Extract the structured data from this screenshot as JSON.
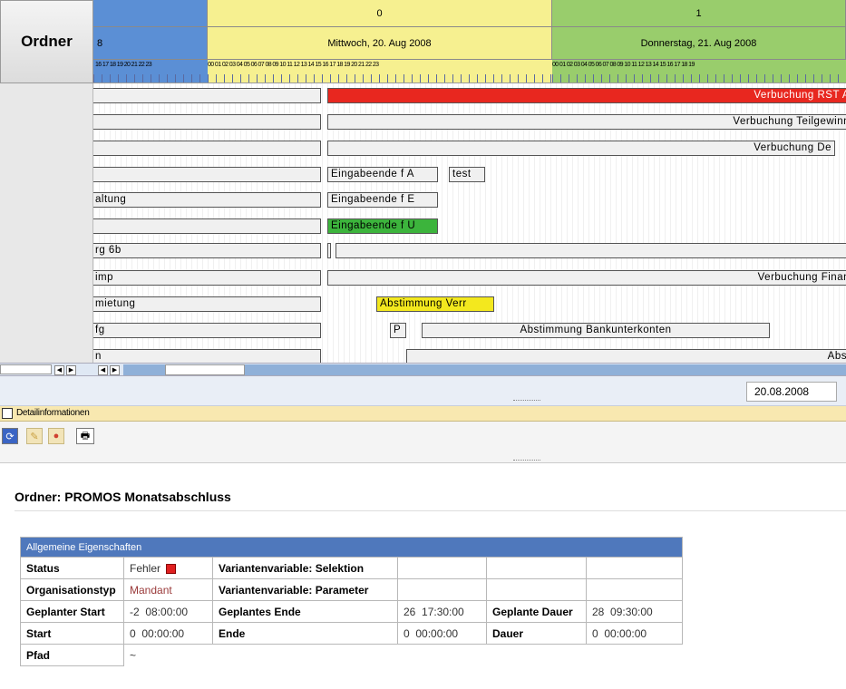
{
  "ordner_button": "Ordner",
  "timeline": {
    "day_index_prev": "",
    "day_index_wed": "0",
    "day_index_thu": "1",
    "day_prev_label": "8",
    "day_wed_label": "Mittwoch, 20. Aug 2008",
    "day_thu_label": "Donnerstag, 21. Aug 2008",
    "hours_prev": "16 17 18 19 20 21 22 23",
    "hours_wed": "00 01 02 03 04 05 06 07 08 09 10 11 12 13 14 15 16 17 18 19 20 21 22 23",
    "hours_thu": "00 01 02 03 04 05 06 07 08 09 10 11 12 13 14 15 16 17 18 19"
  },
  "rows": [
    {
      "left": "",
      "right": "Verbuchung RST A"
    },
    {
      "left": "",
      "right": "Verbuchung Teilgewinn"
    },
    {
      "left": "",
      "right": "Verbuchung De"
    },
    {
      "left": "",
      "mid1": "Eingabeende f A",
      "mid2": "test"
    },
    {
      "left": "altung",
      "mid1": "Eingabeende f E"
    },
    {
      "left": "",
      "mid1": "Eingabeende f U"
    },
    {
      "left": "rg 6b"
    },
    {
      "left": "imp",
      "right": "Verbuchung Finan"
    },
    {
      "left": "mietung",
      "mid1": "Abstimmung Verr"
    },
    {
      "left": "fg",
      "p": "P",
      "mid2": "Abstimmung Bankunterkonten"
    },
    {
      "left": "n",
      "right": "Abs"
    }
  ],
  "date_field": "20.08.2008",
  "detail_header": "Detailinformationen",
  "page_title": "Ordner: PROMOS Monatsabschluss",
  "props": {
    "section": "Allgemeine Eigenschaften",
    "status_label": "Status",
    "status_value": "Fehler",
    "variant_sel_label": "Variantenvariable: Selektion",
    "org_label": "Organisationstyp",
    "org_value": "Mandant",
    "variant_par_label": "Variantenvariable: Parameter",
    "planned_start_label": "Geplanter Start",
    "planned_start_value": "-2  08:00:00",
    "planned_end_label": "Geplantes Ende",
    "planned_end_value": "26  17:30:00",
    "planned_dur_label": "Geplante Dauer",
    "planned_dur_value": "28  09:30:00",
    "start_label": "Start",
    "start_value": "0  00:00:00",
    "end_label": "Ende",
    "end_value": "0  00:00:00",
    "dur_label": "Dauer",
    "dur_value": "0  00:00:00",
    "path_label": "Pfad",
    "path_value": "~"
  },
  "colors": {
    "error": "#e02020",
    "header_blue": "#5b8fd5",
    "day_yellow": "#f6f090",
    "day_green": "#99cd6c"
  }
}
